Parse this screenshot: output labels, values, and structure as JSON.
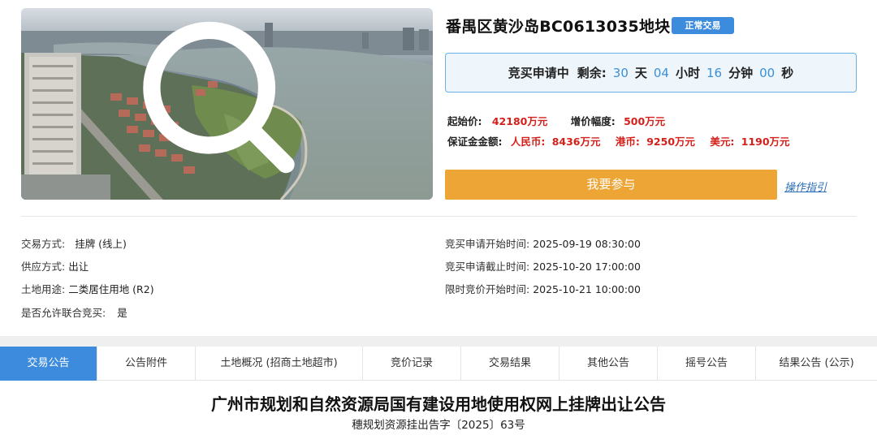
{
  "parcel": {
    "title": "番禺区黄沙岛BC0613035地块",
    "badge": "正常交易"
  },
  "countdown": {
    "status": "竞买申请中",
    "remaining_label": "剩余:",
    "days": "30",
    "days_unit": "天",
    "hours": "04",
    "hours_unit": "小时",
    "minutes": "16",
    "minutes_unit": "分钟",
    "seconds": "00",
    "seconds_unit": "秒"
  },
  "price": {
    "start_label": "起始价:",
    "start_value": "42180万元",
    "increment_label": "增价幅度:",
    "increment_value": "500万元",
    "deposit_label": "保证金金额:",
    "rmb_label": "人民币:",
    "rmb_value": "8436万元",
    "hkd_label": "港币:",
    "hkd_value": "9250万元",
    "usd_label": "美元:",
    "usd_value": "1190万元"
  },
  "actions": {
    "join_label": "我要参与",
    "guide_label": "操作指引"
  },
  "details_left": [
    {
      "key": "交易方式:",
      "value": "挂牌 (线上)"
    },
    {
      "key": "供应方式:",
      "value": "出让"
    },
    {
      "key": "土地用途:",
      "value": "二类居住用地 (R2)"
    },
    {
      "key": "是否允许联合竞买:",
      "value": "是"
    }
  ],
  "details_right": [
    {
      "key": "竞买申请开始时间:",
      "value": "2025-09-19 08:30:00"
    },
    {
      "key": "竞买申请截止时间:",
      "value": "2025-10-20 17:00:00"
    },
    {
      "key": "限时竞价开始时间:",
      "value": "2025-10-21 10:00:00"
    }
  ],
  "tabs": [
    {
      "label": "交易公告",
      "active": true
    },
    {
      "label": "公告附件",
      "active": false
    },
    {
      "label": "土地概况 (招商土地超市)",
      "active": false
    },
    {
      "label": "竞价记录",
      "active": false
    },
    {
      "label": "交易结果",
      "active": false
    },
    {
      "label": "其他公告",
      "active": false
    },
    {
      "label": "摇号公告",
      "active": false
    },
    {
      "label": "结果公告 (公示)",
      "active": false
    }
  ],
  "announcement": {
    "title": "广州市规划和自然资源局国有建设用地使用权网上挂牌出让公告",
    "doc_no": "穗规划资源挂出告字〔2025〕63号"
  },
  "icons": {
    "zoom": "search-icon"
  },
  "colors": {
    "accent_blue": "#3d8bdc",
    "price_red": "#d4201a",
    "join_orange": "#eda636"
  }
}
